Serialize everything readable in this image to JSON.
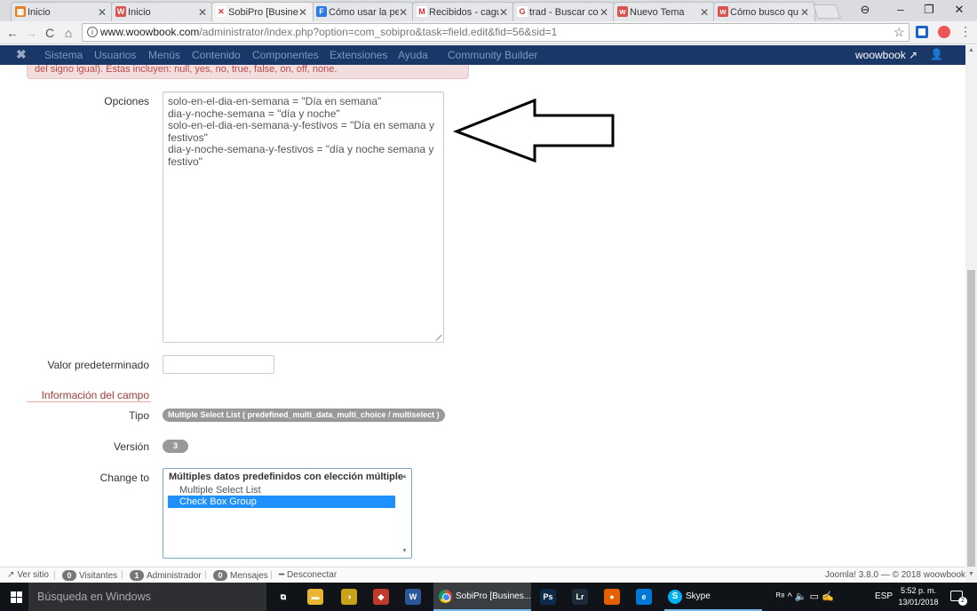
{
  "browser": {
    "tabs": [
      {
        "label": "Inicio",
        "fav_color": "#e67e22",
        "fav_glyph": "▦",
        "active": false
      },
      {
        "label": "Inicio",
        "fav_color": "#d9534f",
        "fav_glyph": "W",
        "active": false
      },
      {
        "label": "SobiPro [Busines",
        "fav_color": "#ffffff",
        "fav_glyph": "✕",
        "active": true
      },
      {
        "label": "Cómo usar la pe",
        "fav_color": "#2a7ae2",
        "fav_glyph": "F",
        "active": false
      },
      {
        "label": "Recibidos - cagu",
        "fav_color": "#ffffff",
        "fav_glyph": "M",
        "active": false
      },
      {
        "label": "trad - Buscar co",
        "fav_color": "#ffffff",
        "fav_glyph": "G",
        "active": false
      },
      {
        "label": "Nuevo Tema",
        "fav_color": "#d9534f",
        "fav_glyph": "w",
        "active": false
      },
      {
        "label": "Cómo busco qu",
        "fav_color": "#d9534f",
        "fav_glyph": "w",
        "active": false
      }
    ],
    "tab_close_glyph": "✕",
    "url_host": "www.woowbook.com",
    "url_path": "/administrator/index.php?option=com_sobipro&task=field.edit&fid=56&sid=1",
    "info_glyph": "i",
    "nav": {
      "back": "←",
      "forward": "→",
      "reload": "C",
      "home": "⌂"
    },
    "win": {
      "profile": "⊖",
      "minimize": "–",
      "restore": "❐",
      "close": "✕"
    },
    "star_glyph": "☆",
    "kebab_glyph": "⋮"
  },
  "joomla_nav": {
    "logo_glyph": "✖",
    "menu": [
      "Sistema",
      "Usuarios",
      "Menús",
      "Contenido",
      "Componentes",
      "Extensiones",
      "Ayuda",
      "Community Builder"
    ],
    "site_name": "woowbook",
    "ext_glyph": "↗",
    "user_glyph": "👤"
  },
  "alert": {
    "text": "del signo igual). Estas incluyen: null, yes, no, true, false, on, off, none."
  },
  "form": {
    "options_label": "Opciones",
    "options_value": "solo-en-el-dia-en-semana = \"Día en semana\"\ndia-y-noche-semana = \"día y noche\"\nsolo-en-el-dia-en-semana-y-festivos = \"Día en semana y\nfestivos\"\ndia-y-noche-semana-y-festivos = \"día y noche semana y festivo\"",
    "default_label": "Valor predeterminado",
    "default_value": "",
    "section_legend": "Información del campo",
    "type_label": "Tipo",
    "type_badge": "Multiple Select List ( predefined_multi_data_multi_choice / multiselect )",
    "version_label": "Versión",
    "version_badge": "3",
    "change_label": "Change to",
    "change_optgroup": "Múltiples datos predefinidos con elección múltiple",
    "change_options": [
      {
        "label": "Multiple Select List",
        "selected": false
      },
      {
        "label": "Check Box Group",
        "selected": true
      }
    ],
    "scroll_up": "▲",
    "scroll_down": "▼"
  },
  "footer": {
    "ver_sitio": "Ver sitio",
    "visitantes_count": "0",
    "visitantes": "Visitantes",
    "admin_count": "1",
    "admin": "Administrador",
    "mensajes_count": "0",
    "mensajes": "Mensajes",
    "desconectar": "Desconectar",
    "version": "Joomla! 3.8.0 — © 2018 woowbook",
    "ext_glyph": "↗",
    "dash_glyph": "━",
    "sep": "|"
  },
  "taskbar": {
    "search_placeholder": "Búsqueda en Windows",
    "active_app": "SobiPro [Busines...",
    "skype": "Skype",
    "skype_glyph": "S",
    "lang": "ESP",
    "time": "5:52 p. m.",
    "date": "13/01/2018",
    "notif_count": "2",
    "icons": [
      {
        "name": "task-view-icon",
        "glyph": "⧉",
        "color": "transparent"
      },
      {
        "name": "file-explorer-icon",
        "glyph": "▬",
        "color": "#e8b631"
      },
      {
        "name": "app-yellow-icon",
        "glyph": "◑",
        "color": "#c9a21a"
      },
      {
        "name": "app-red-icon",
        "glyph": "◆",
        "color": "#c0392b"
      },
      {
        "name": "word-icon",
        "glyph": "W",
        "color": "#2b579a"
      },
      {
        "name": "photoshop-icon",
        "glyph": "Ps",
        "color": "#0b2c4a"
      },
      {
        "name": "lightroom-icon",
        "glyph": "Lr",
        "color": "#1c2a3a"
      },
      {
        "name": "firefox-icon",
        "glyph": "●",
        "color": "#e66000"
      },
      {
        "name": "edge-icon",
        "glyph": "e",
        "color": "#0078d7"
      }
    ],
    "tray_glyphs": "ᴿ⁸  ^  🔈  ▭  ✍"
  }
}
